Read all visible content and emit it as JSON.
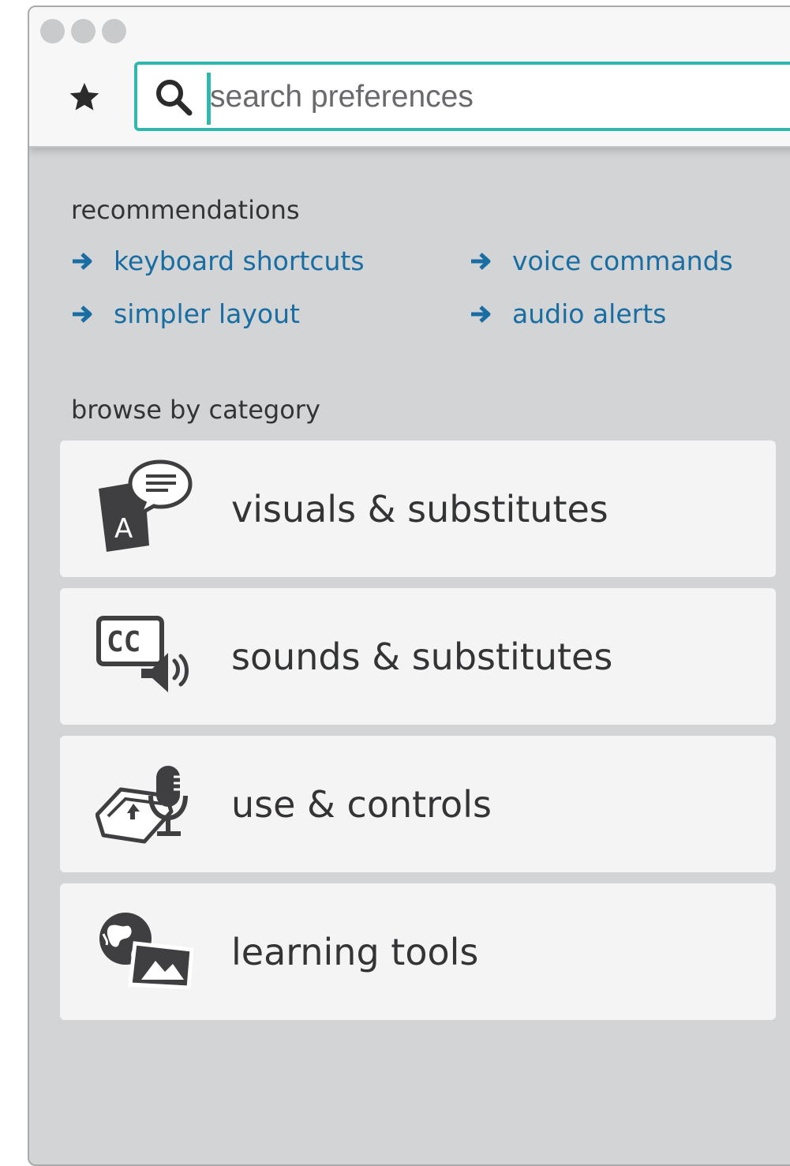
{
  "search": {
    "placeholder": "search preferences"
  },
  "recommendations": {
    "heading": "recommendations",
    "items": [
      {
        "label": "keyboard shortcuts"
      },
      {
        "label": "voice commands"
      },
      {
        "label": "simpler layout"
      },
      {
        "label": "audio alerts"
      }
    ]
  },
  "categories": {
    "heading": "browse by category",
    "items": [
      {
        "label": "visuals & substitutes",
        "icon": "text-bubble-icon"
      },
      {
        "label": "sounds & substitutes",
        "icon": "captions-speaker-icon"
      },
      {
        "label": "use & controls",
        "icon": "keyboard-microphone-icon"
      },
      {
        "label": "learning tools",
        "icon": "globe-picture-icon"
      }
    ]
  },
  "colors": {
    "accent": "#2fb8ab",
    "link": "#186da3",
    "panel": "#d3d4d6",
    "card": "#f4f4f5"
  }
}
